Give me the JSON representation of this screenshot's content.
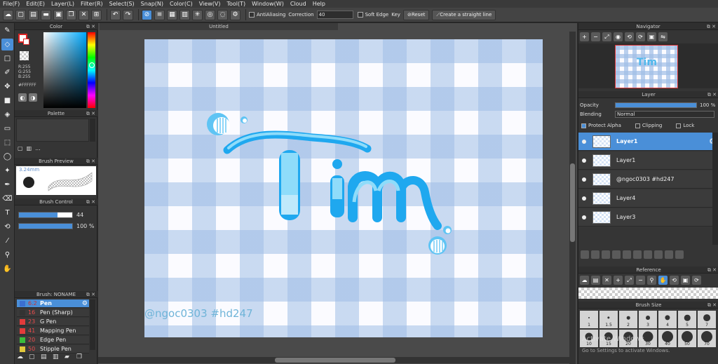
{
  "menu": [
    "File(F)",
    "Edit(E)",
    "Layer(L)",
    "Filter(R)",
    "Select(S)",
    "Snap(N)",
    "Color(C)",
    "View(V)",
    "Tool(T)",
    "Window(W)",
    "Cloud",
    "Help"
  ],
  "toolbar": {
    "antialiasing_label": "AntiAliasing",
    "correction_label": "Correction",
    "correction_value": "40",
    "soft_edge_label": "Soft Edge",
    "key_label": "Key",
    "reset_label": "Reset",
    "straight_line_label": "Create a straight line"
  },
  "color_panel": {
    "title": "Color",
    "r": "R:255",
    "g": "G:255",
    "b": "B:255",
    "hex": "#FFFFFF"
  },
  "palette_panel": {
    "title": "Palette",
    "dots": "..."
  },
  "brush_preview": {
    "title": "Brush Preview",
    "size": "3.24mm"
  },
  "brush_control": {
    "title": "Brush Control",
    "size_value": "44",
    "size_fraction": 0.72,
    "opacity_value": "100 %",
    "opacity_fraction": 1.0
  },
  "brush_list": {
    "title": "Brush: NONAME",
    "items": [
      {
        "size": "6.2",
        "name": "Pen",
        "color": "#3b6fd1",
        "active": true
      },
      {
        "size": "16",
        "name": "Pen (Sharp)",
        "color": "#333333",
        "active": false
      },
      {
        "size": "23",
        "name": "G Pen",
        "color": "#e23b3b",
        "active": false
      },
      {
        "size": "41",
        "name": "Mapping Pen",
        "color": "#e23b3b",
        "active": false
      },
      {
        "size": "20",
        "name": "Edge Pen",
        "color": "#3bbd3b",
        "active": false
      },
      {
        "size": "50",
        "name": "Stipple Pen",
        "color": "#e2c83b",
        "active": false
      }
    ]
  },
  "document": {
    "tab_title": "Untitled",
    "watermark": "@ngoc0303  #hd247"
  },
  "navigator": {
    "title": "Navigator",
    "thumb_text": "Tim"
  },
  "layer_panel": {
    "title": "Layer",
    "opacity_label": "Opacity",
    "opacity_value": "100 %",
    "blending_label": "Blending",
    "blending_value": "Normal",
    "protect_alpha": "Protect Alpha",
    "clipping": "Clipping",
    "lock": "Lock",
    "layers": [
      {
        "name": "Layer1",
        "active": true
      },
      {
        "name": "Layer1",
        "active": false
      },
      {
        "name": "@ngoc0303  #hd247",
        "active": false
      },
      {
        "name": "Layer4",
        "active": false
      },
      {
        "name": "Layer3",
        "active": false
      }
    ]
  },
  "reference_panel": {
    "title": "Reference"
  },
  "brush_size_panel": {
    "title": "Brush Size",
    "sizes": [
      "1",
      "1.5",
      "2",
      "3",
      "4",
      "5",
      "7",
      "10",
      "15",
      "20",
      "30",
      "40",
      "50",
      "70"
    ]
  },
  "os_watermark": {
    "line1": "Activate Windows",
    "line2": "Go to Settings to activate Windows."
  }
}
